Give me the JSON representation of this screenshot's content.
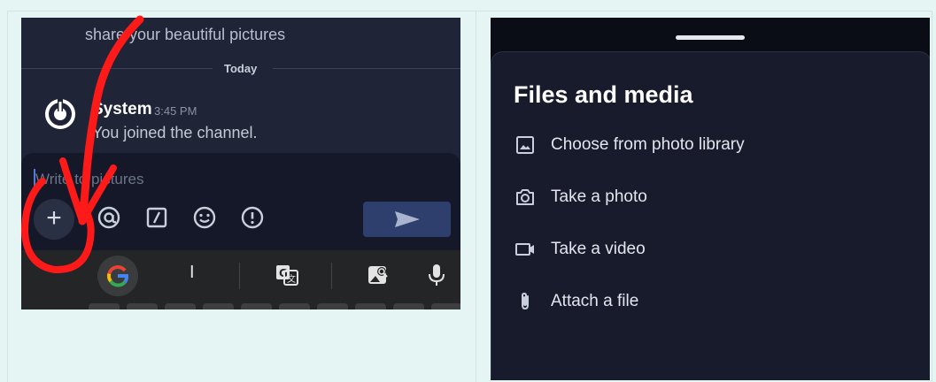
{
  "chat": {
    "prev_message_tail": "share your beautiful pictures",
    "date_separator": "Today",
    "system_post": {
      "author": "System",
      "time": "3:45 PM",
      "message": "You joined the channel."
    },
    "composer": {
      "placeholder": "Write to pictures",
      "plus_label": "+",
      "tools": [
        "at-mention",
        "slash-command",
        "emoji",
        "priority"
      ]
    }
  },
  "files_sheet": {
    "title": "Files and media",
    "items": [
      {
        "icon": "image-icon",
        "label": "Choose from photo library"
      },
      {
        "icon": "camera-icon",
        "label": "Take a photo"
      },
      {
        "icon": "video-icon",
        "label": "Take a video"
      },
      {
        "icon": "paperclip-icon",
        "label": "Attach a file"
      }
    ]
  },
  "colors": {
    "annotation": "#ff1a1a",
    "chat_bg": "#1f2436",
    "send_button": "#2e3f6e",
    "sheet_bg": "#171b2b"
  }
}
